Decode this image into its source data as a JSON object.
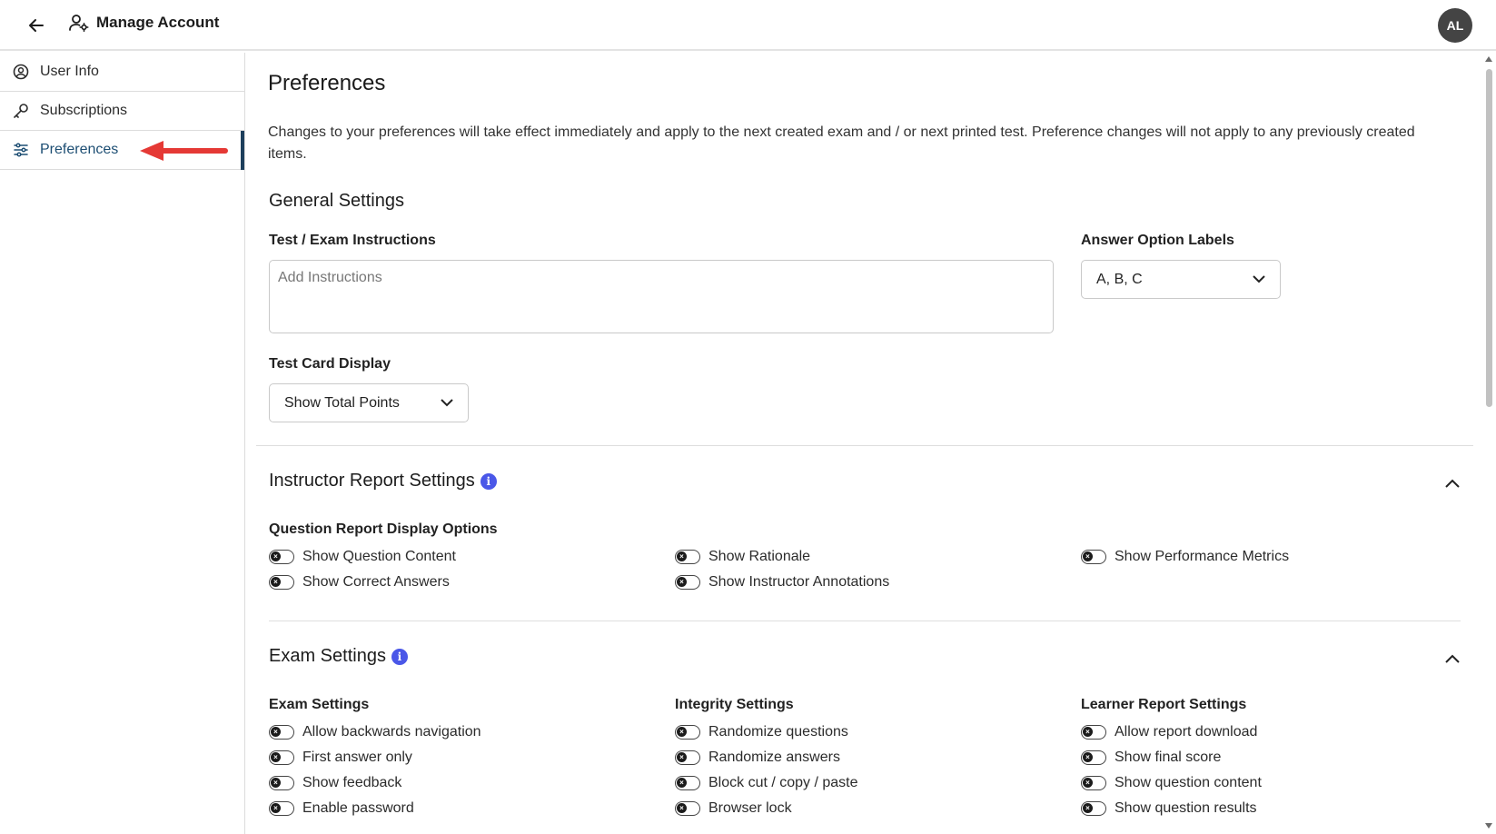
{
  "header": {
    "back_icon": "arrow-left-icon",
    "title_icon": "user-gear-icon",
    "title": "Manage Account",
    "avatar_initials": "AL"
  },
  "sidebar": {
    "items": [
      {
        "label": "User Info",
        "icon": "user-circle-icon",
        "active": false
      },
      {
        "label": "Subscriptions",
        "icon": "key-icon",
        "active": false
      },
      {
        "label": "Preferences",
        "icon": "sliders-icon",
        "active": true
      }
    ],
    "annotation_color": "#e53935"
  },
  "main": {
    "title": "Preferences",
    "description": "Changes to your preferences will take effect immediately and apply to the next created exam and / or next printed test. Preference changes will not apply to any previously created items.",
    "general": {
      "heading": "General Settings",
      "instructions_label": "Test / Exam Instructions",
      "instructions_placeholder": "Add Instructions",
      "instructions_value": "",
      "answer_labels_label": "Answer Option Labels",
      "answer_labels_value": "A, B, C",
      "test_card_label": "Test Card Display",
      "test_card_value": "Show Total Points"
    },
    "instructor_report": {
      "heading": "Instructor Report Settings",
      "subheading": "Question Report Display Options",
      "toggles": [
        {
          "label": "Show Question Content",
          "on": false
        },
        {
          "label": "Show Correct Answers",
          "on": false
        },
        {
          "label": "Show Rationale",
          "on": false
        },
        {
          "label": "Show Instructor Annotations",
          "on": false
        },
        {
          "label": "Show Performance Metrics",
          "on": false
        }
      ]
    },
    "exam": {
      "heading": "Exam Settings",
      "columns": [
        {
          "title": "Exam Settings",
          "toggles": [
            {
              "label": "Allow backwards navigation",
              "on": false
            },
            {
              "label": "First answer only",
              "on": false
            },
            {
              "label": "Show feedback",
              "on": false
            },
            {
              "label": "Enable password",
              "on": false
            }
          ]
        },
        {
          "title": "Integrity Settings",
          "toggles": [
            {
              "label": "Randomize questions",
              "on": false
            },
            {
              "label": "Randomize answers",
              "on": false
            },
            {
              "label": "Block cut / copy / paste",
              "on": false
            },
            {
              "label": "Browser lock",
              "on": false
            }
          ]
        },
        {
          "title": "Learner Report Settings",
          "toggles": [
            {
              "label": "Allow report download",
              "on": false
            },
            {
              "label": "Show final score",
              "on": false
            },
            {
              "label": "Show question content",
              "on": false
            },
            {
              "label": "Show question results",
              "on": false
            }
          ]
        }
      ]
    }
  },
  "colors": {
    "accent": "#1d3f5c",
    "info": "#4a57e8",
    "avatar_bg": "#444444"
  }
}
